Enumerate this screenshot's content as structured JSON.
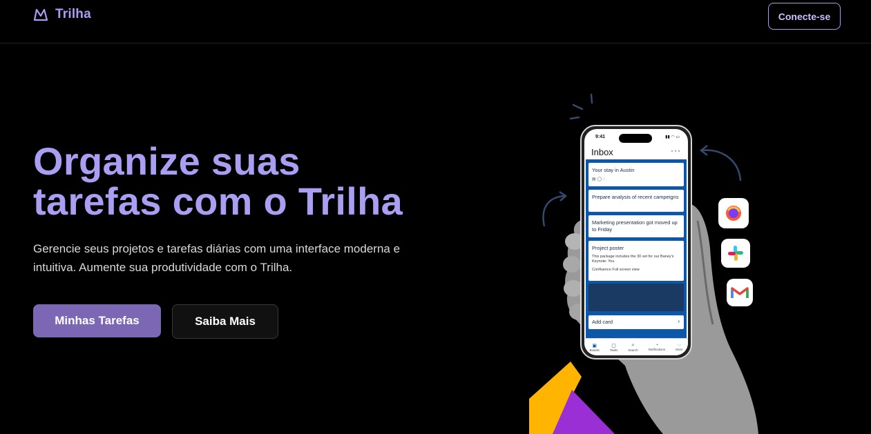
{
  "header": {
    "brand_name": "Trilha",
    "login_label": "Conecte-se"
  },
  "hero": {
    "headline_line1": "Organize suas",
    "headline_line2": "tarefas com o Trilha",
    "subtitle": "Gerencie seus projetos e tarefas diárias com uma interface moderna e intuitiva. Aumente sua produtividade com o Trilha.",
    "primary_cta": "Minhas Tarefas",
    "secondary_cta": "Saiba Mais"
  },
  "phone": {
    "time": "9:41",
    "inbox_title": "Inbox",
    "more": "···",
    "cards": [
      {
        "title": "Your stay in Austin"
      },
      {
        "title": "Prepare analysis of recent campeigns"
      },
      {
        "title": "Marketing presentation got moved up to Friday"
      },
      {
        "title": "Project poster",
        "desc": "This package includes the 30 set for our Baney's Keynote: You",
        "foot": "Confluence   Full screen view"
      }
    ],
    "add_card": "Add card",
    "nav": [
      "Boards",
      "Tasks",
      "Search",
      "Notifications",
      "More"
    ]
  },
  "colors": {
    "accent": "#a99ef2",
    "primary_button": "#7c67b4",
    "background": "#000000",
    "trello_blue": "#0d57a8",
    "shape_yellow": "#ffb400",
    "shape_purple": "#9b2fd6"
  }
}
